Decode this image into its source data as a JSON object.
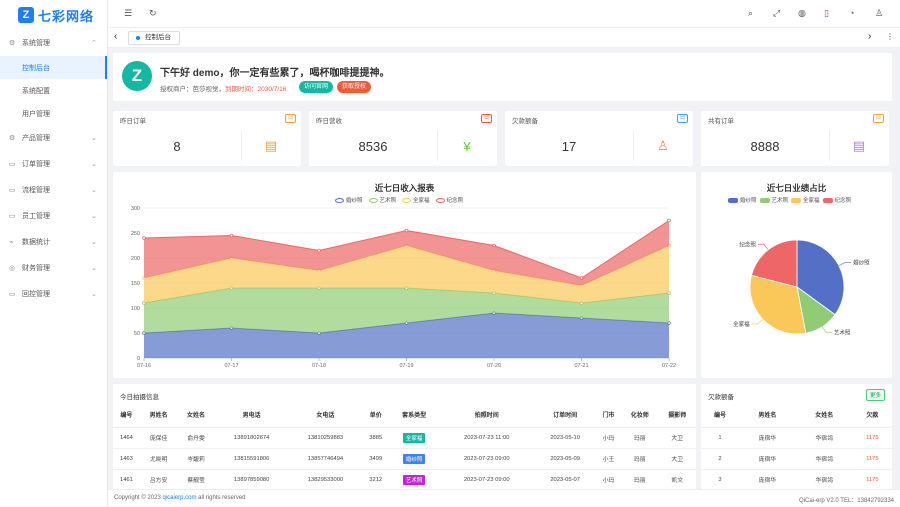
{
  "app": {
    "logo_mark": "Z",
    "logo_text": "七彩网络"
  },
  "sidebar": {
    "groups": [
      {
        "label": "系统管理",
        "icon": "⚙",
        "chev": "⌃",
        "open": true,
        "children": [
          {
            "label": "控制后台",
            "active": true
          },
          {
            "label": "系统配置"
          },
          {
            "label": "用户管理"
          }
        ]
      },
      {
        "label": "产品管理",
        "icon": "⚙",
        "chev": "⌄"
      },
      {
        "label": "订单管理",
        "icon": "▭",
        "chev": "⌄"
      },
      {
        "label": "流程管理",
        "icon": "▭",
        "chev": "⌄"
      },
      {
        "label": "员工管理",
        "icon": "▭",
        "chev": "⌄"
      },
      {
        "label": "数据统计",
        "icon": "⌁",
        "chev": "⌄"
      },
      {
        "label": "财务管理",
        "icon": "◎",
        "chev": "⌄"
      },
      {
        "label": "回控管理",
        "icon": "▭",
        "chev": "⌄"
      }
    ]
  },
  "topbar": {
    "menu_icon": "☰",
    "refresh_icon": "↻",
    "icons": [
      "⌕",
      "⤢",
      "◍",
      "▯",
      "◔",
      "♙"
    ]
  },
  "tagbar": {
    "tab_label": "控制后台",
    "prev": "‹",
    "next": "›",
    "more": "⋮"
  },
  "welcome": {
    "avatar": "Z",
    "greeting": "下午好 demo，你一定有些累了，喝杯咖啡提提神。",
    "tenant_label": "授权商户：",
    "tenant": "芭莎视觉，",
    "expire_label": "到期时间：",
    "expire": "2030/7/16",
    "btn_visit": "访问官网",
    "btn_auth": "获取授权"
  },
  "stats": [
    {
      "title": "昨日订单",
      "badge": "日",
      "value": "8",
      "color": "#e6a23c",
      "icon": "▤"
    },
    {
      "title": "昨日营收",
      "badge": "日",
      "value": "8536",
      "color": "#67c23a",
      "icon": "¥",
      "badge_color": "#ee5b3b"
    },
    {
      "title": "欠款额备",
      "badge": "日",
      "value": "17",
      "color": "#fa8c5a",
      "icon": "♙",
      "badge_color": "#409eff"
    },
    {
      "title": "共有订单",
      "badge": "日",
      "value": "8888",
      "color": "#b47cf0",
      "icon": "▤",
      "badge_color": "#e6a23c"
    }
  ],
  "area_chart": {
    "title": "近七日收入报表",
    "legend": [
      "婚纱照",
      "艺术照",
      "全家福",
      "纪念照"
    ]
  },
  "pie_chart": {
    "title": "近七日业绩占比",
    "legend": [
      "婚纱照",
      "艺术照",
      "全家福",
      "纪念照"
    ]
  },
  "chart_data": [
    {
      "type": "area",
      "title": "近七日收入报表",
      "stacked": true,
      "x": [
        "07-16",
        "07-17",
        "07-18",
        "07-19",
        "07-20",
        "07-21",
        "07-22"
      ],
      "ylim": [
        0,
        300
      ],
      "yticks": [
        0,
        50,
        100,
        150,
        200,
        250,
        300
      ],
      "legend_position": "top",
      "series": [
        {
          "name": "婚纱照",
          "color": "#5470c6",
          "values": [
            50,
            60,
            50,
            70,
            90,
            80,
            70
          ]
        },
        {
          "name": "艺术照",
          "color": "#91cc75",
          "values": [
            60,
            80,
            90,
            70,
            40,
            30,
            60
          ]
        },
        {
          "name": "全家福",
          "color": "#fac858",
          "values": [
            50,
            60,
            35,
            85,
            45,
            35,
            95
          ]
        },
        {
          "name": "纪念照",
          "color": "#ee6666",
          "values": [
            80,
            45,
            40,
            30,
            50,
            15,
            50
          ]
        }
      ]
    },
    {
      "type": "pie",
      "title": "近七日业绩占比",
      "legend_position": "top",
      "labels": [
        "婚纱照",
        "艺术照",
        "全家福",
        "纪念照"
      ],
      "values": [
        35,
        12,
        32,
        21
      ],
      "colors": [
        "#5470c6",
        "#91cc75",
        "#fac858",
        "#ee6666"
      ]
    }
  ],
  "photo_table": {
    "title": "今日拍摄信息",
    "columns": [
      "编号",
      "男姓名",
      "女姓名",
      "男电话",
      "女电话",
      "单价",
      "套系类型",
      "拍照时间",
      "订单时间",
      "门市",
      "化妆师",
      "摄影师"
    ],
    "rows": [
      [
        "1464",
        "庞保佳",
        "俞丹雯",
        "13891802674",
        "13810259883",
        "3885",
        "全家福",
        "2023-07-23 11:00",
        "2023-05-10",
        "小玛",
        "玛丽",
        "大卫"
      ],
      [
        "1463",
        "尤晓明",
        "岑馥莉",
        "13815591806",
        "13857746494",
        "3499",
        "婚纱照",
        "2023-07-23 09:00",
        "2023-05-09",
        "小王",
        "玛丽",
        "大卫"
      ],
      [
        "1461",
        "吕方安",
        "蔡靓莹",
        "13897859080",
        "13829533000",
        "3212",
        "艺术照",
        "2023-07-23 09:00",
        "2023-05-07",
        "小玛",
        "玛丽",
        "凯文"
      ]
    ],
    "pkg_colors": {
      "全家福": "#13b7a2",
      "婚纱照": "#3b82f6",
      "艺术照": "#c026d3"
    }
  },
  "debt_table": {
    "title": "欠款额备",
    "more": "更多",
    "columns": [
      "编号",
      "男姓名",
      "女姓名",
      "欠款"
    ],
    "rows": [
      [
        "1",
        "庞宿华",
        "华宿鸰",
        "1175"
      ],
      [
        "2",
        "庞宿华",
        "华宿鸰",
        "1175"
      ],
      [
        "3",
        "庞宿华",
        "华宿鸰",
        "1175"
      ]
    ]
  },
  "footer": {
    "copy": "Copyright © 2023 ",
    "link": "qicaierp.com",
    "rights": " all rights reserved",
    "version": "QiCai-erp V2.0 TEL：13842792334"
  }
}
